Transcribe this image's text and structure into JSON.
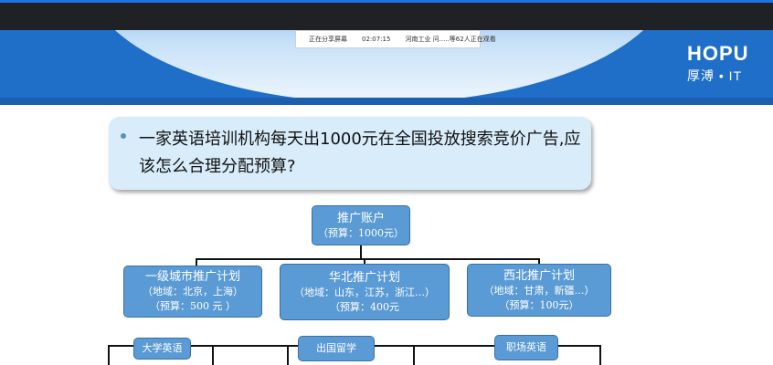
{
  "screen_share": {
    "status": "正在分享屏幕",
    "time": "02:07:15",
    "viewers": "河南工业 问.....等62人正在观看"
  },
  "logo": {
    "brand": "HOPU",
    "subtitle": "厚溥 • IT"
  },
  "question": {
    "text": "一家英语培训机构每天出1000元在全国投放搜索竞价广告,应该怎么合理分配预算?"
  },
  "tree": {
    "root": {
      "title": "推广账户",
      "budget": "（预算：1000元）"
    },
    "plans": [
      {
        "title": "一级城市推广计划",
        "region": "（地域：北京，上海）",
        "budget": "（预算：500 元 ）"
      },
      {
        "title": "华北推广计划",
        "region": "（地域：山东，江苏，浙江…）",
        "budget": "（预算：400元"
      },
      {
        "title": "西北推广计划",
        "region": "（地域：甘肃，新疆…）",
        "budget": "（预算：100元）"
      }
    ],
    "units": [
      {
        "title": "大学英语"
      },
      {
        "title": "出国留学"
      },
      {
        "title": "职场英语"
      }
    ]
  },
  "colors": {
    "node_fill": "#5b9bd5",
    "banner_blue": "#1f6fc8",
    "question_bg": "#d8ecfa"
  }
}
